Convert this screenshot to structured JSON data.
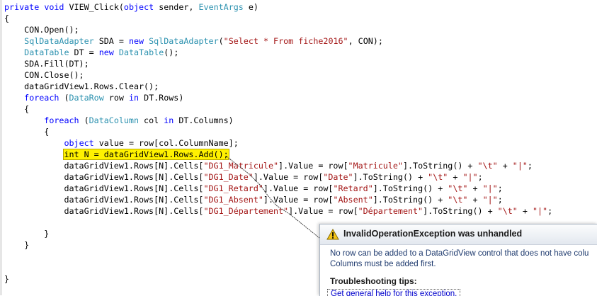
{
  "code": {
    "lines": [
      [
        {
          "t": "private",
          "c": "kw"
        },
        {
          "t": " "
        },
        {
          "t": "void",
          "c": "kw"
        },
        {
          "t": " VIEW_Click("
        },
        {
          "t": "object",
          "c": "kw"
        },
        {
          "t": " sender, "
        },
        {
          "t": "EventArgs",
          "c": "ty"
        },
        {
          "t": " e)"
        }
      ],
      [
        {
          "t": "{"
        }
      ],
      [
        {
          "t": "    CON.Open();"
        }
      ],
      [
        {
          "t": "    "
        },
        {
          "t": "SqlDataAdapter",
          "c": "ty"
        },
        {
          "t": " SDA = "
        },
        {
          "t": "new",
          "c": "kw"
        },
        {
          "t": " "
        },
        {
          "t": "SqlDataAdapter",
          "c": "ty"
        },
        {
          "t": "("
        },
        {
          "t": "\"Select * From fiche2016\"",
          "c": "st"
        },
        {
          "t": ", CON);"
        }
      ],
      [
        {
          "t": "    "
        },
        {
          "t": "DataTable",
          "c": "ty"
        },
        {
          "t": " DT = "
        },
        {
          "t": "new",
          "c": "kw"
        },
        {
          "t": " "
        },
        {
          "t": "DataTable",
          "c": "ty"
        },
        {
          "t": "();"
        }
      ],
      [
        {
          "t": "    SDA.Fill(DT);"
        }
      ],
      [
        {
          "t": "    CON.Close();"
        }
      ],
      [
        {
          "t": "    dataGridView1.Rows.Clear();"
        }
      ],
      [
        {
          "t": "    "
        },
        {
          "t": "foreach",
          "c": "kw"
        },
        {
          "t": " ("
        },
        {
          "t": "DataRow",
          "c": "ty"
        },
        {
          "t": " row "
        },
        {
          "t": "in",
          "c": "kw"
        },
        {
          "t": " DT.Rows)"
        }
      ],
      [
        {
          "t": "    {"
        }
      ],
      [
        {
          "t": "        "
        },
        {
          "t": "foreach",
          "c": "kw"
        },
        {
          "t": " ("
        },
        {
          "t": "DataColumn",
          "c": "ty"
        },
        {
          "t": " col "
        },
        {
          "t": "in",
          "c": "kw"
        },
        {
          "t": " DT.Columns)"
        }
      ],
      [
        {
          "t": "        {"
        }
      ],
      [
        {
          "t": "            "
        },
        {
          "t": "object",
          "c": "kw"
        },
        {
          "t": " value = row[col.ColumnName];"
        }
      ],
      [
        {
          "t": "            "
        },
        {
          "t": "int N = dataGridView1.Rows.Add();",
          "c": "hl"
        }
      ],
      [
        {
          "t": "            dataGridView1.Rows[N].Cells["
        },
        {
          "t": "\"DG1_Matricule\"",
          "c": "st"
        },
        {
          "t": "].Value = row["
        },
        {
          "t": "\"Matricule\"",
          "c": "st"
        },
        {
          "t": "].ToString() + "
        },
        {
          "t": "\"\\t\"",
          "c": "st"
        },
        {
          "t": " + "
        },
        {
          "t": "\"|\"",
          "c": "st"
        },
        {
          "t": ";"
        }
      ],
      [
        {
          "t": "            dataGridView1.Rows[N].Cells["
        },
        {
          "t": "\"DG1_Date\"",
          "c": "st"
        },
        {
          "t": "].Value = row["
        },
        {
          "t": "\"Date\"",
          "c": "st"
        },
        {
          "t": "].ToString() + "
        },
        {
          "t": "\"\\t\"",
          "c": "st"
        },
        {
          "t": " + "
        },
        {
          "t": "\"|\"",
          "c": "st"
        },
        {
          "t": ";"
        }
      ],
      [
        {
          "t": "            dataGridView1.Rows[N].Cells["
        },
        {
          "t": "\"DG1_Retard\"",
          "c": "st"
        },
        {
          "t": "].Value = row["
        },
        {
          "t": "\"Retard\"",
          "c": "st"
        },
        {
          "t": "].ToString() + "
        },
        {
          "t": "\"\\t\"",
          "c": "st"
        },
        {
          "t": " + "
        },
        {
          "t": "\"|\"",
          "c": "st"
        },
        {
          "t": ";"
        }
      ],
      [
        {
          "t": "            dataGridView1.Rows[N].Cells["
        },
        {
          "t": "\"DG1_Absent\"",
          "c": "st"
        },
        {
          "t": "].Value = row["
        },
        {
          "t": "\"Absent\"",
          "c": "st"
        },
        {
          "t": "].ToString() + "
        },
        {
          "t": "\"\\t\"",
          "c": "st"
        },
        {
          "t": " + "
        },
        {
          "t": "\"|\"",
          "c": "st"
        },
        {
          "t": ";"
        }
      ],
      [
        {
          "t": "            dataGridView1.Rows[N].Cells["
        },
        {
          "t": "\"DG1_Département\"",
          "c": "st"
        },
        {
          "t": "].Value = row["
        },
        {
          "t": "\"Département\"",
          "c": "st"
        },
        {
          "t": "].ToString() + "
        },
        {
          "t": "\"\\t\"",
          "c": "st"
        },
        {
          "t": " + "
        },
        {
          "t": "\"|\"",
          "c": "st"
        },
        {
          "t": ";"
        }
      ],
      [
        {
          "t": ""
        }
      ],
      [
        {
          "t": "        }"
        }
      ],
      [
        {
          "t": "    }"
        }
      ],
      [
        {
          "t": ""
        }
      ],
      [
        {
          "t": ""
        }
      ],
      [
        {
          "t": "}"
        }
      ]
    ]
  },
  "exception": {
    "title": "InvalidOperationException was unhandled",
    "message_line1": "No row can be added to a DataGridView control that does not have colu",
    "message_line2": "Columns must be added first.",
    "tips_heading": "Troubleshooting tips:",
    "tip_link": "Get general help for this exception.",
    "icon": "warning-icon",
    "colors": {
      "highlight": "#fff200",
      "keyword": "#0000ff",
      "type": "#2b91af",
      "string": "#a31515"
    }
  }
}
